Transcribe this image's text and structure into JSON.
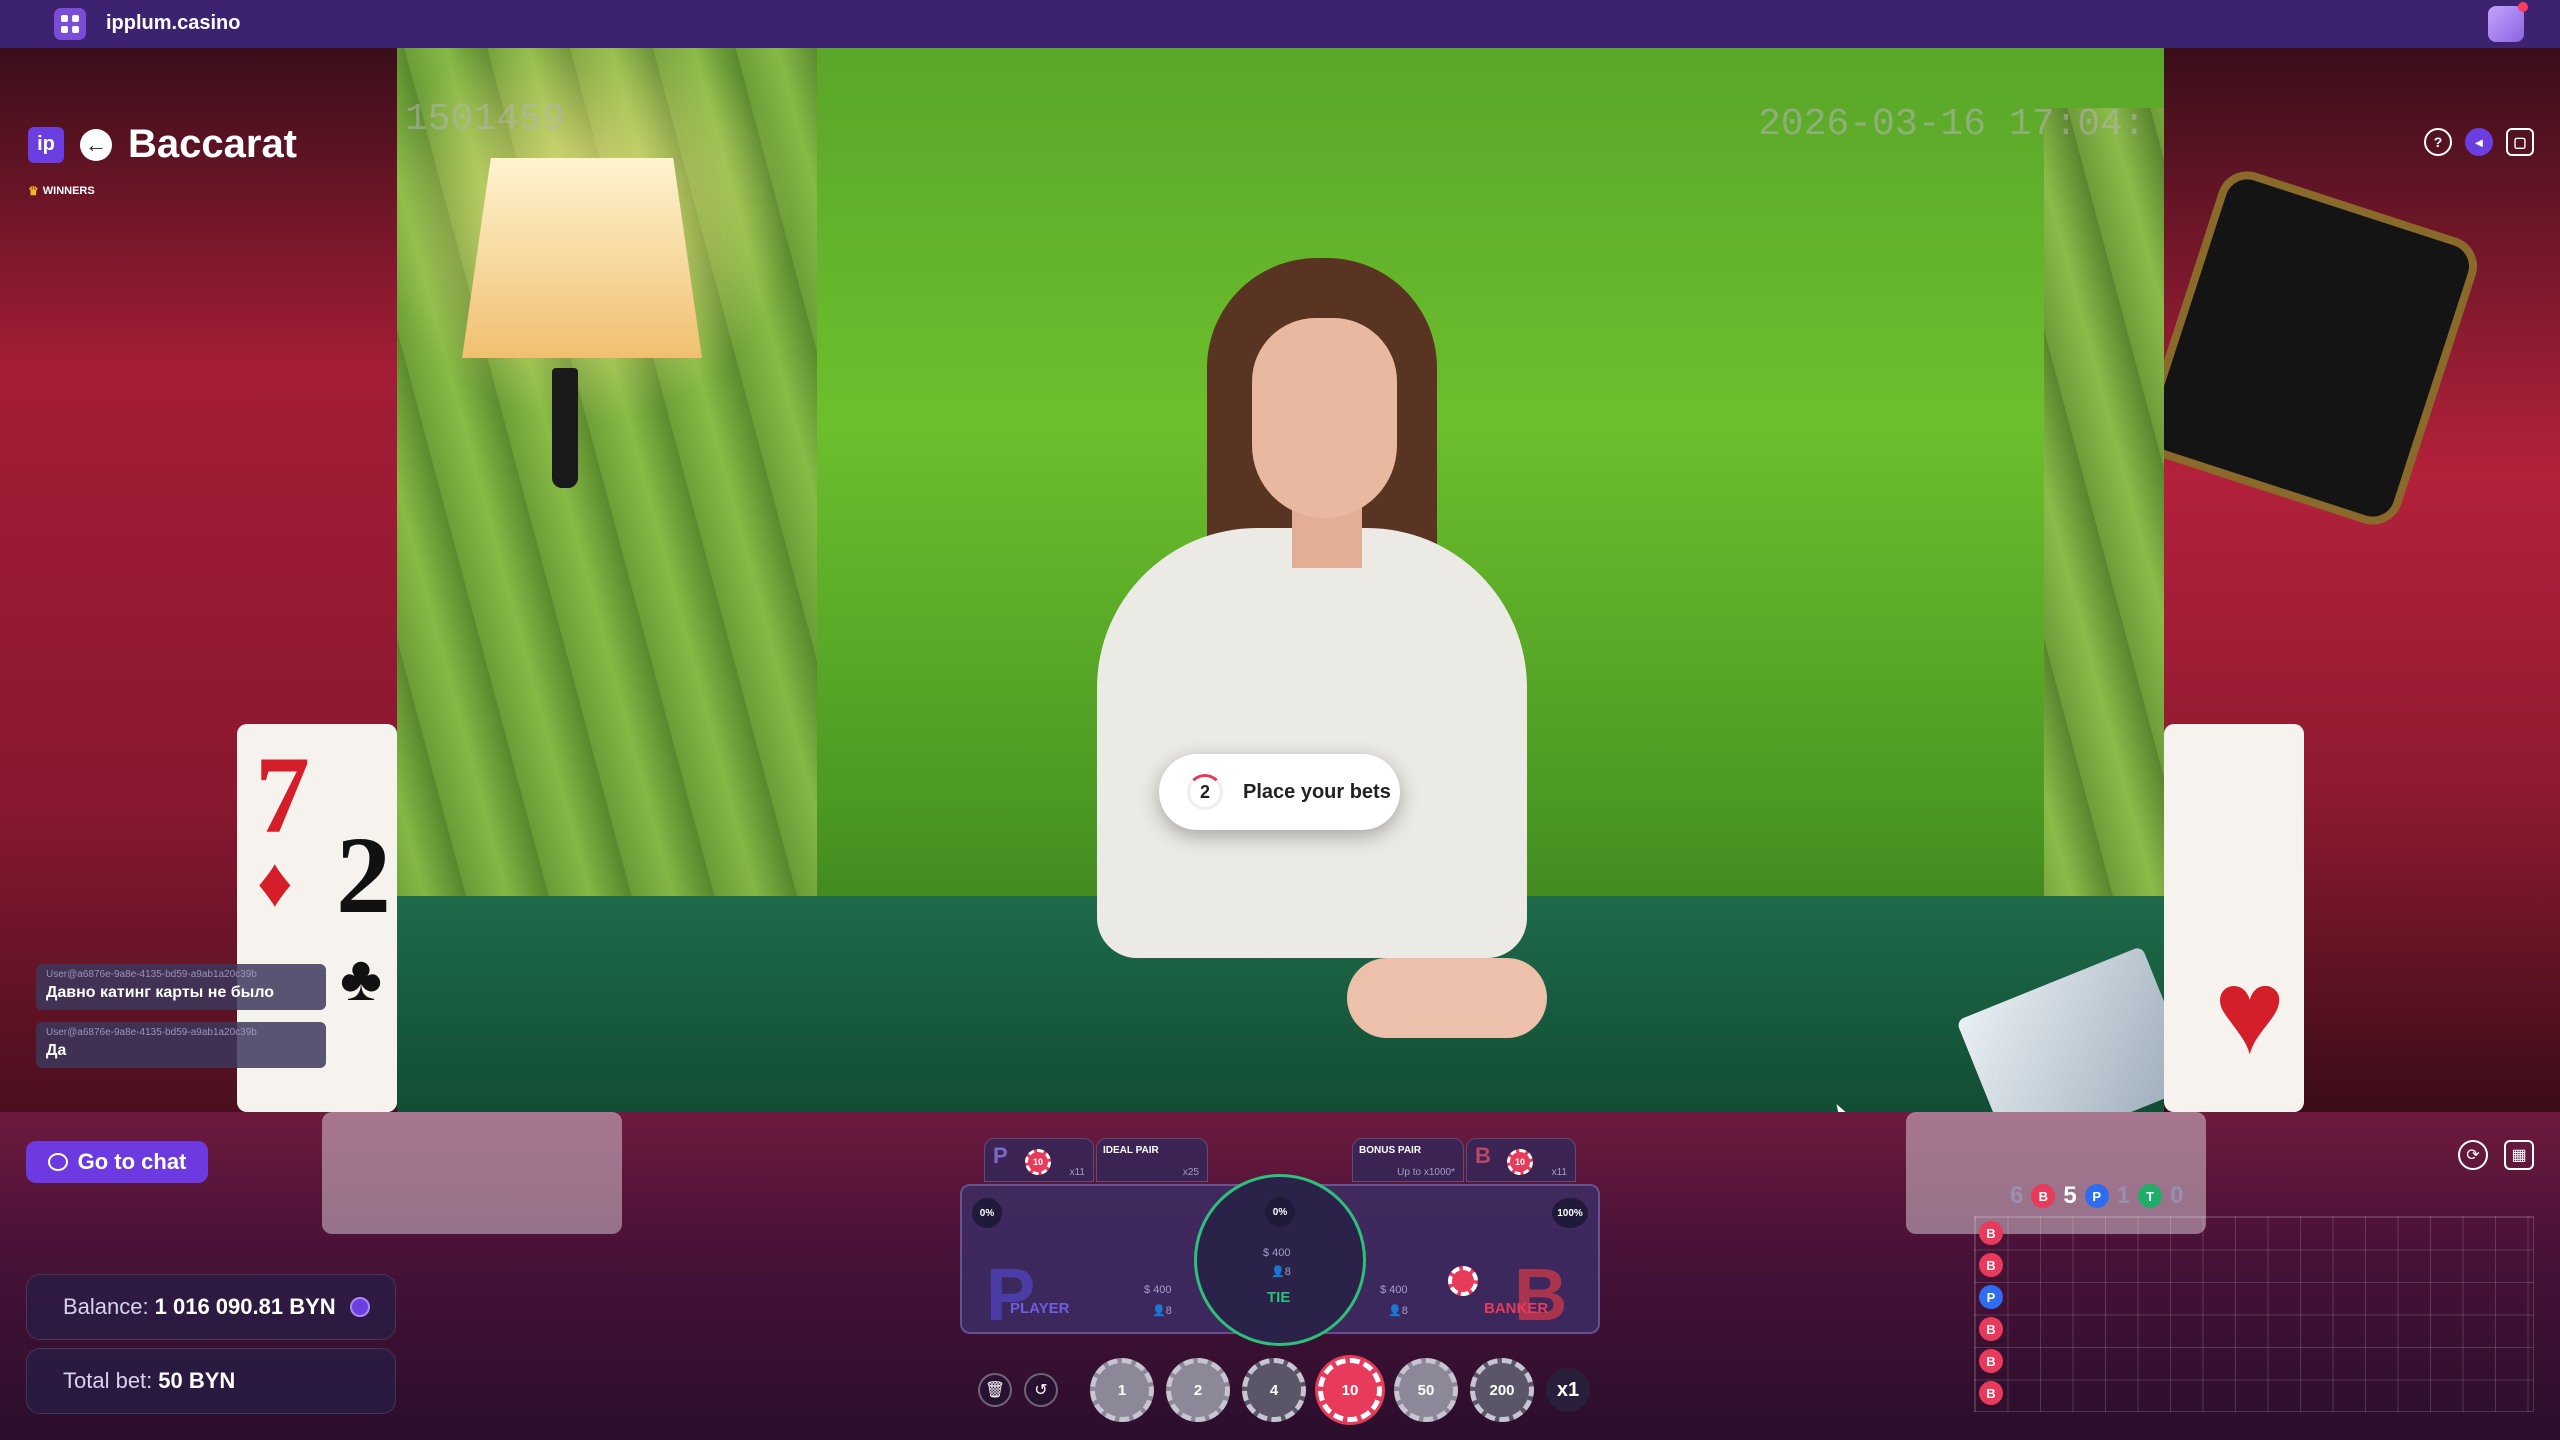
{
  "topbar": {
    "site": "ipplum.casino"
  },
  "game": {
    "logo": "ip",
    "title": "Baccarat",
    "winners": "WINNERS",
    "back_icon": "←"
  },
  "video": {
    "round_id": "1501459",
    "timestamp": "2026-03-16 17:04:"
  },
  "top_icons": {
    "help": "?",
    "mute": "🔇",
    "fullscreen": "⛶"
  },
  "status": {
    "countdown": "2",
    "message": "Place your bets"
  },
  "chat": [
    {
      "user": "User@a6876e-9a8e-4135-bd59-a9ab1a20c39b",
      "text": "Давно катинг карты не было"
    },
    {
      "user": "User@a6876e-9a8e-4135-bd59-a9ab1a20c39b",
      "text": "Да"
    }
  ],
  "cards_left": [
    {
      "rank": "7",
      "suit": "♦"
    },
    {
      "rank": "2",
      "suit": "♣"
    }
  ],
  "go_chat": "Go to chat",
  "balance": {
    "label": "Balance:",
    "value": "1 016 090.81 BYN"
  },
  "total_bet": {
    "label": "Total bet:",
    "value": "50 BYN"
  },
  "side_bets": {
    "player_pair": {
      "logo": "P",
      "chip": "10",
      "payout": "x11"
    },
    "ideal_pair": {
      "label": "IDEAL PAIR",
      "payout": "x25"
    },
    "bonus_pair": {
      "label": "BONUS PAIR",
      "payout": "Up to x1000*"
    },
    "banker_pair": {
      "logo": "B",
      "chip": "10",
      "payout": "x11"
    }
  },
  "betting_table": {
    "player": {
      "label": "PLAYER",
      "pct": "0%",
      "amount": "$ 400",
      "players": "8"
    },
    "tie": {
      "label": "TIE",
      "pct": "0%",
      "amount": "$ 400",
      "players": "8"
    },
    "banker": {
      "label": "BANKER",
      "pct": "100%",
      "amount": "$ 400",
      "players": "8"
    }
  },
  "chips": [
    "1",
    "2",
    "4",
    "10",
    "50",
    "200"
  ],
  "selected_chip": "10",
  "multiplier": "x1",
  "controls": {
    "clear": "🗑",
    "undo": "↺"
  },
  "road_summary": {
    "banker_count": "6",
    "banker_letter": "B",
    "player_count": "5",
    "player_letter": "P",
    "tie_count": "1",
    "tie_letter": "T",
    "tie_total": "0"
  },
  "road": [
    "B",
    "B",
    "P",
    "B",
    "B",
    "B"
  ],
  "bottom_icons": {
    "refresh": "⟳",
    "stats": "▦"
  },
  "colors": {
    "accent": "#6c3ae0",
    "banker": "#e83a5a",
    "player": "#2e6cf0",
    "tie": "#1fae6a"
  }
}
